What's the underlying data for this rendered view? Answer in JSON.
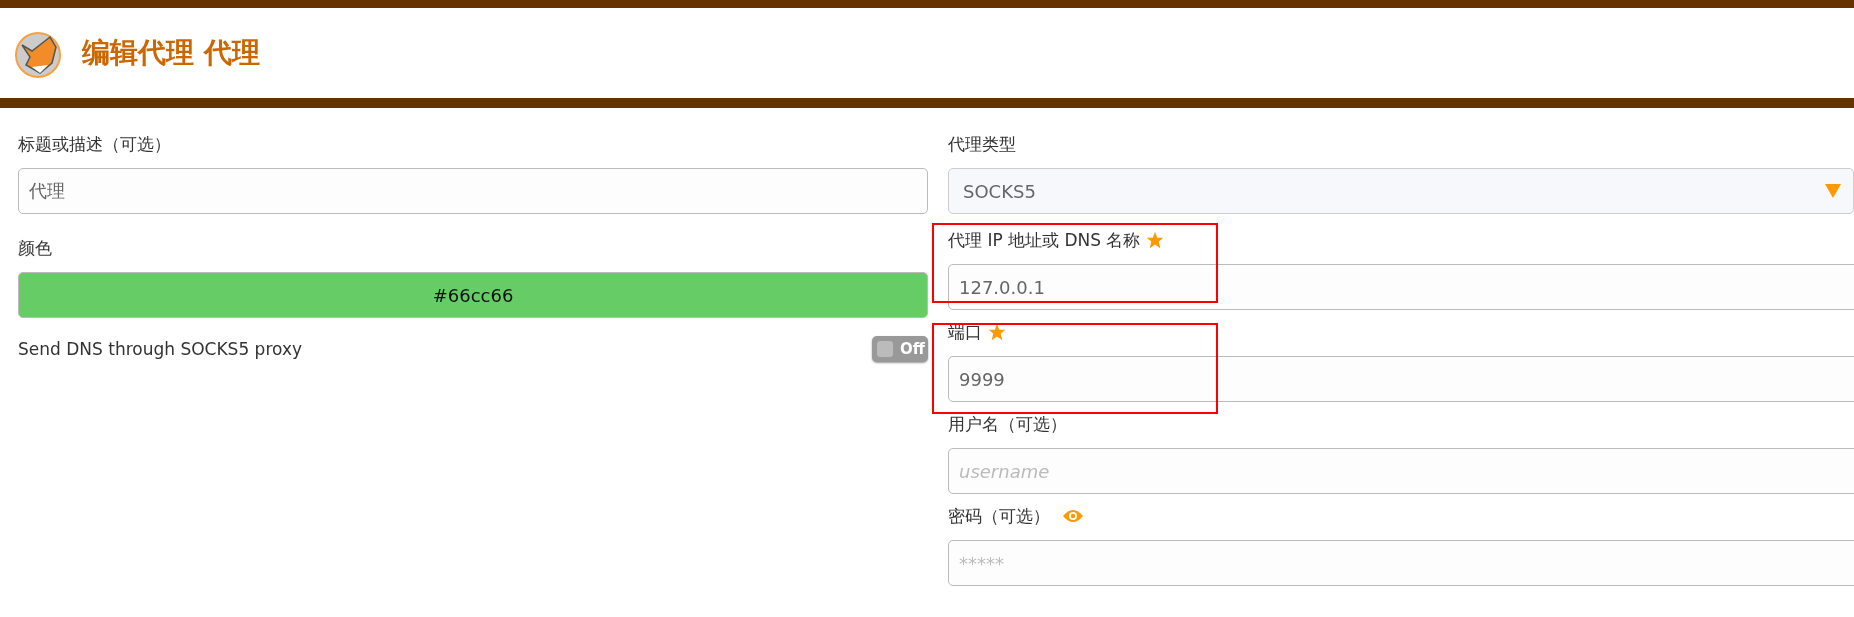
{
  "header": {
    "title": "编辑代理 代理"
  },
  "left": {
    "title_field": {
      "label": "标题或描述（可选）",
      "value": "代理"
    },
    "color_field": {
      "label": "颜色",
      "value": "#66cc66",
      "color": "#66cc66"
    },
    "dns_toggle": {
      "label": "Send DNS through SOCKS5 proxy",
      "on": false,
      "state_text": "Off"
    }
  },
  "right": {
    "type_field": {
      "label": "代理类型",
      "value": "SOCKS5"
    },
    "fields": [
      {
        "label": "代理 IP 地址或 DNS 名称",
        "required": true,
        "value": "127.0.0.1",
        "highlighted": true,
        "reveal": false
      },
      {
        "label": "端口",
        "required": true,
        "value": "9999",
        "highlighted": true,
        "reveal": false
      },
      {
        "label": "用户名（可选）",
        "required": false,
        "placeholder": "username",
        "highlighted": false,
        "reveal": false
      },
      {
        "label": "密码（可选）",
        "required": false,
        "placeholder": "*****",
        "highlighted": false,
        "reveal": true
      }
    ]
  }
}
